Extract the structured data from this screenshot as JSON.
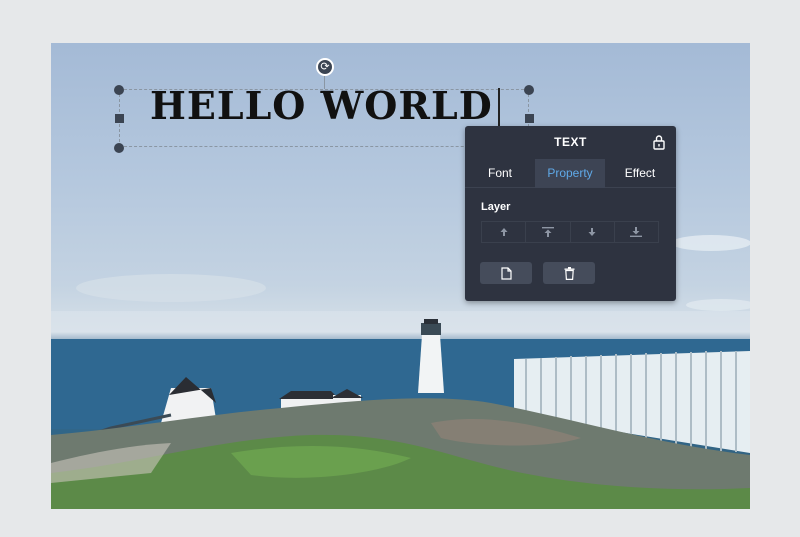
{
  "canvas": {
    "text_content": "HELLO WORLD"
  },
  "panel": {
    "title": "TEXT",
    "lock_icon": "lock-icon",
    "tabs": [
      {
        "label": "Font",
        "active": false
      },
      {
        "label": "Property",
        "active": true
      },
      {
        "label": "Effect",
        "active": false
      }
    ],
    "layer_label": "Layer",
    "layer_buttons": [
      "move-up-icon",
      "bring-to-front-icon",
      "move-down-icon",
      "send-to-back-icon"
    ],
    "action_buttons": [
      "duplicate-icon",
      "delete-icon"
    ]
  },
  "colors": {
    "panel_bg": "#2e3340",
    "active_tab_text": "#5fa9e8",
    "page_bg": "#e6e8ea"
  }
}
